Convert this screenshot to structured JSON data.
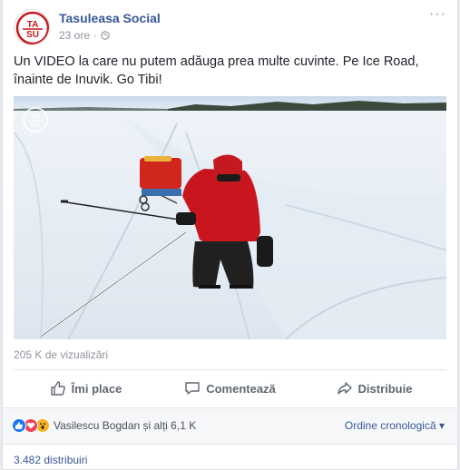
{
  "post": {
    "page_name": "Tasuleasa Social",
    "time": "23 ore",
    "separator": "·",
    "more": "···",
    "text": "Un VIDEO la care nu putem adăuga prea multe cuvinte. Pe Ice Road, înainte de Inuvik. Go Tibi!",
    "views": "205 K de vizualizări",
    "avatar_text_top": "TA",
    "avatar_text_bottom": "SU"
  },
  "actions": {
    "like": "Îmi place",
    "comment": "Comentează",
    "share": "Distribuie"
  },
  "reactions": {
    "icons": [
      "like-reaction",
      "love-reaction",
      "wow-reaction"
    ],
    "summary": "Vasilescu Bogdan și alți 6,1 K",
    "order": "Ordine cronologică",
    "order_caret": "▾"
  },
  "shares": "3.482 distribuiri",
  "colors": {
    "brand": "#365899",
    "avatar_red": "#c8161d",
    "like_blue": "#1877f2",
    "love_red": "#f33e58",
    "wow_yellow": "#f7b125"
  }
}
